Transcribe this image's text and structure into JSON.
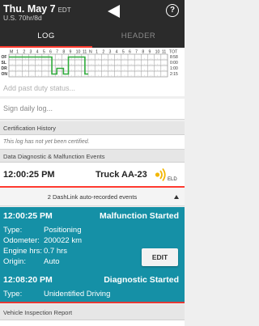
{
  "header": {
    "date": "Thu. May 7",
    "timezone": "EDT",
    "hours_rule": "U.S. 70hr/8d",
    "help_glyph": "?"
  },
  "tabs": [
    {
      "label": "LOG",
      "active": true
    },
    {
      "label": "HEADER",
      "active": false
    }
  ],
  "log_graph": {
    "rows": [
      "OF",
      "SL",
      "DR",
      "ON"
    ],
    "hour_labels": [
      "M",
      "1",
      "2",
      "3",
      "4",
      "5",
      "6",
      "7",
      "8",
      "9",
      "10",
      "11",
      "N",
      "1",
      "2",
      "3",
      "4",
      "5",
      "6",
      "7",
      "8",
      "9",
      "10",
      "11"
    ],
    "total_header": "TOT",
    "totals": [
      "8:58",
      "0:00",
      "1:00",
      "2:15"
    ],
    "line_color": "#2eaa3a"
  },
  "add_past_duty": "Add past duty status...",
  "sign_log": "Sign daily log...",
  "certification": {
    "title": "Certification History",
    "note": "This log has not yet been certified."
  },
  "diagnostics": {
    "title": "Data Diagnostic & Malfunction Events",
    "time": "12:00:25 PM",
    "truck": "Truck AA-23",
    "eld_label": "ELD",
    "eld_icon": "eld-signal-icon",
    "events_summary": "2 DashLink auto-recorded events",
    "card_color": "#1590a6",
    "events": [
      {
        "time": "12:00:25 PM",
        "status": "Malfunction Started",
        "fields": [
          {
            "key": "Type:",
            "value": "Positioning"
          },
          {
            "key": "Odometer:",
            "value": "200022 km"
          },
          {
            "key": "Engine hrs:",
            "value": "0.7 hrs"
          },
          {
            "key": "Origin:",
            "value": "Auto"
          }
        ],
        "edit_label": "EDIT"
      },
      {
        "time": "12:08:20 PM",
        "status": "Diagnostic Started",
        "fields": [
          {
            "key": "Type:",
            "value": "Unidentified Driving"
          }
        ]
      }
    ]
  },
  "vehicle_inspection": "Vehicle Inspection Report"
}
